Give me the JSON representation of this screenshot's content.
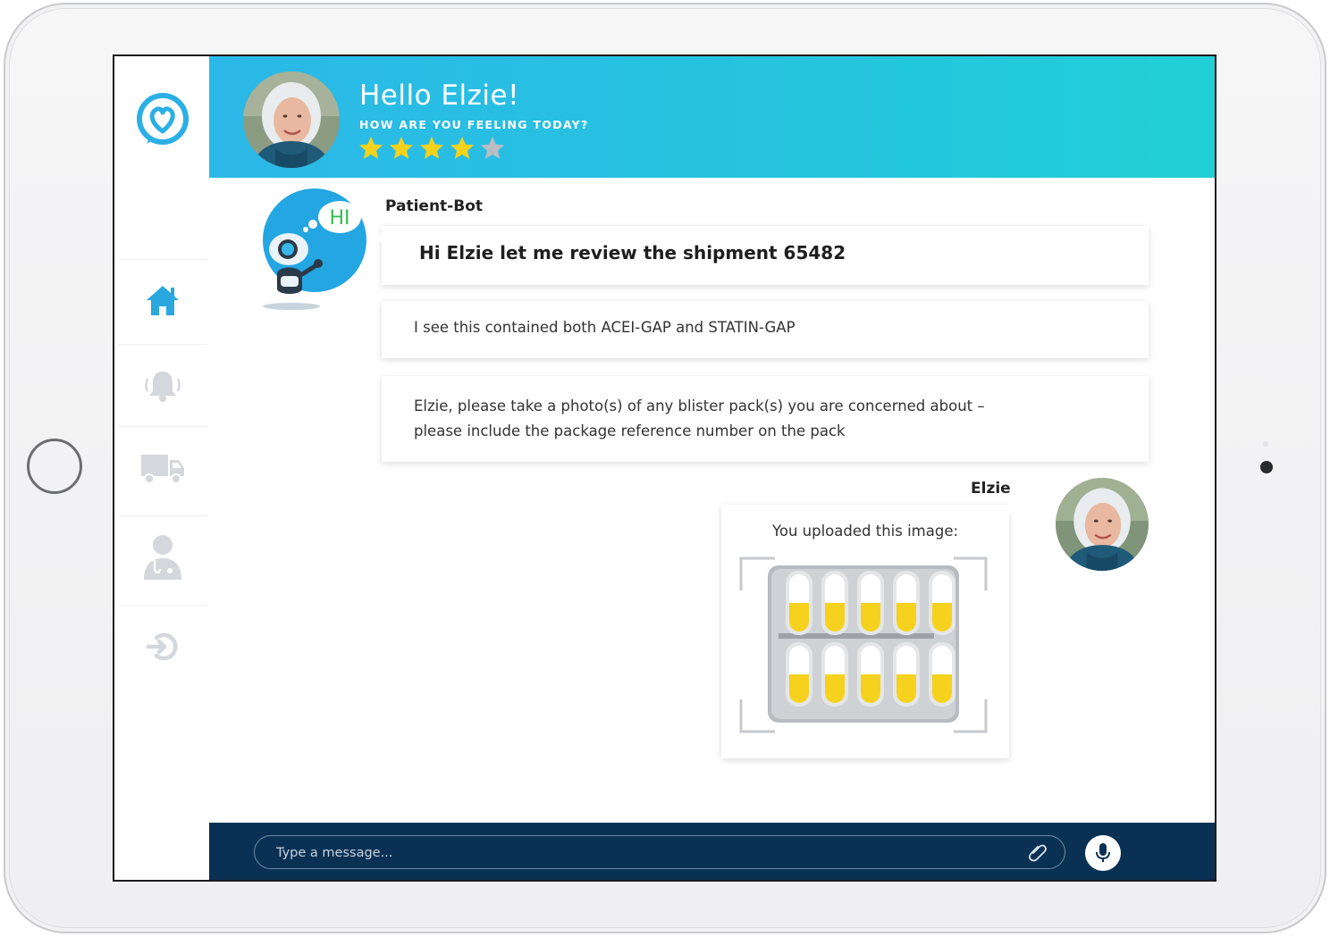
{
  "header": {
    "title": "Hello Elzie!",
    "subtitle": "HOW ARE YOU FEELING TODAY?",
    "rating": 4,
    "rating_max": 5
  },
  "sidebar": {
    "items": [
      {
        "icon": "home-icon",
        "active": true
      },
      {
        "icon": "bell-icon",
        "active": false
      },
      {
        "icon": "truck-icon",
        "active": false
      },
      {
        "icon": "doctor-icon",
        "active": false
      },
      {
        "icon": "logout-icon",
        "active": false
      }
    ]
  },
  "chat": {
    "bot": {
      "name": "Patient-Bot",
      "bubble_text": "HI"
    },
    "messages": [
      {
        "sender": "bot",
        "text": "Hi Elzie let me review the shipment 65482"
      },
      {
        "sender": "bot",
        "text": "I see this contained both ACEI-GAP and STATIN-GAP"
      },
      {
        "sender": "bot",
        "text_line1": "Elzie, please take a photo(s) of any blister pack(s) you are concerned about –",
        "text_line2": "please include the package reference number on the pack"
      },
      {
        "sender": "user",
        "text": "You uploaded this image:"
      }
    ],
    "user": {
      "name": "Elzie"
    }
  },
  "composer": {
    "placeholder": "Type a message..."
  },
  "colors": {
    "header_start": "#2bb8e8",
    "header_end": "#21cfd7",
    "accent": "#29a9e0",
    "bottom_bar": "#0a3154",
    "star_on": "#f7d21b",
    "star_off": "#b9bec5"
  }
}
